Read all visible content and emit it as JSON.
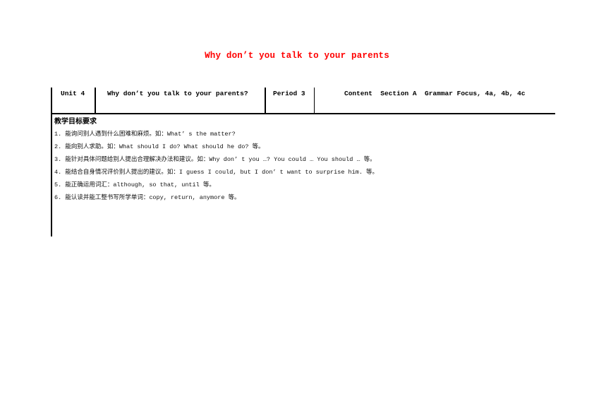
{
  "document": {
    "title": "Why don’t you talk to your parents",
    "title_color": "#ff0000"
  },
  "header": {
    "unit": "Unit 4",
    "lesson_title": "Why don’t you talk to your parents?",
    "period": "Period 3",
    "content": "Content  Section A  Grammar Focus, 4a, 4b, 4c"
  },
  "objectives": {
    "heading": "教学目标要求",
    "items": [
      {
        "num": "1. ",
        "text": "能询问别人遇到什么困难和麻烦。如：What’ s the matter?"
      },
      {
        "num": "2. ",
        "text": "能向别人求助。如：What should I do? What should he do? 等。"
      },
      {
        "num": "3. ",
        "text": "能针对具体问题给别人提出合理解决办法和建议。如：Why don’ t you …? You could … You should … 等。"
      },
      {
        "num": "4. ",
        "text": "能结合自身情况评价别人提出的建议。如：I guess I could, but I don’ t want to surprise him. 等。"
      },
      {
        "num": "5. ",
        "text": "能正确运用词汇：although, so that, until 等。"
      },
      {
        "num": "6. ",
        "text": "能认读并能工整书写所学单词：copy, return, anymore 等。"
      }
    ]
  }
}
